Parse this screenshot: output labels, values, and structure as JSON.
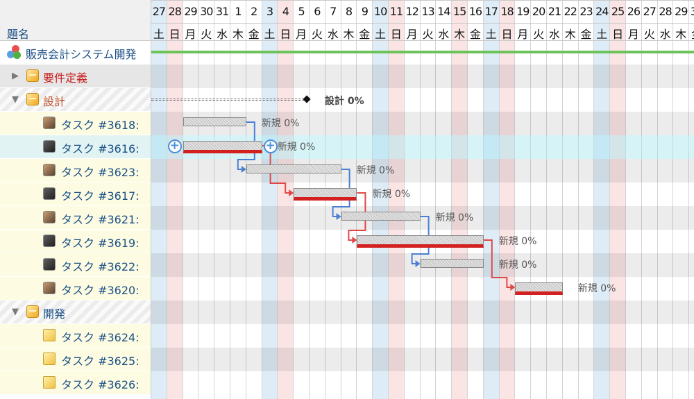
{
  "header": {
    "column_title": "題名",
    "days": [
      {
        "d": "27",
        "w": "土",
        "t": "sat"
      },
      {
        "d": "28",
        "w": "日",
        "t": "sun"
      },
      {
        "d": "29",
        "w": "月",
        "t": ""
      },
      {
        "d": "30",
        "w": "火",
        "t": ""
      },
      {
        "d": "31",
        "w": "水",
        "t": ""
      },
      {
        "d": "1",
        "w": "木",
        "t": ""
      },
      {
        "d": "2",
        "w": "金",
        "t": ""
      },
      {
        "d": "3",
        "w": "土",
        "t": "sat"
      },
      {
        "d": "4",
        "w": "日",
        "t": "sun"
      },
      {
        "d": "5",
        "w": "月",
        "t": ""
      },
      {
        "d": "6",
        "w": "火",
        "t": ""
      },
      {
        "d": "7",
        "w": "水",
        "t": ""
      },
      {
        "d": "8",
        "w": "木",
        "t": ""
      },
      {
        "d": "9",
        "w": "金",
        "t": ""
      },
      {
        "d": "10",
        "w": "土",
        "t": "sat"
      },
      {
        "d": "11",
        "w": "日",
        "t": "sun"
      },
      {
        "d": "12",
        "w": "月",
        "t": ""
      },
      {
        "d": "13",
        "w": "火",
        "t": ""
      },
      {
        "d": "14",
        "w": "水",
        "t": ""
      },
      {
        "d": "15",
        "w": "木",
        "t": "sun"
      },
      {
        "d": "16",
        "w": "金",
        "t": ""
      },
      {
        "d": "17",
        "w": "土",
        "t": "sat"
      },
      {
        "d": "18",
        "w": "日",
        "t": "sun"
      },
      {
        "d": "19",
        "w": "月",
        "t": ""
      },
      {
        "d": "20",
        "w": "火",
        "t": ""
      },
      {
        "d": "21",
        "w": "水",
        "t": ""
      },
      {
        "d": "22",
        "w": "木",
        "t": ""
      },
      {
        "d": "23",
        "w": "金",
        "t": ""
      },
      {
        "d": "24",
        "w": "土",
        "t": "sat"
      },
      {
        "d": "25",
        "w": "日",
        "t": "sun"
      },
      {
        "d": "26",
        "w": "月",
        "t": ""
      },
      {
        "d": "27",
        "w": "火",
        "t": ""
      },
      {
        "d": "28",
        "w": "水",
        "t": ""
      },
      {
        "d": "29",
        "w": "木",
        "t": ""
      },
      {
        "d": "30",
        "w": "金",
        "t": ""
      }
    ]
  },
  "rows": [
    {
      "kind": "project",
      "label": "販売会計システム開発",
      "name": "row-project"
    },
    {
      "kind": "group",
      "label": "要件定義",
      "open": false,
      "color": "#c81e1e",
      "name": "row-group-requirements"
    },
    {
      "kind": "group",
      "label": "設計",
      "open": true,
      "color": "#c0502a",
      "name": "row-group-design"
    },
    {
      "kind": "task",
      "label": "タスク #3618:",
      "avatar": "av1",
      "name": "row-task-3618"
    },
    {
      "kind": "task",
      "label": "タスク #3616:",
      "avatar": "av2",
      "name": "row-task-3616",
      "selected": true
    },
    {
      "kind": "task",
      "label": "タスク #3623:",
      "avatar": "av1",
      "name": "row-task-3623"
    },
    {
      "kind": "task",
      "label": "タスク #3617:",
      "avatar": "av2",
      "name": "row-task-3617"
    },
    {
      "kind": "task",
      "label": "タスク #3621:",
      "avatar": "av1",
      "name": "row-task-3621"
    },
    {
      "kind": "task",
      "label": "タスク #3619:",
      "avatar": "av2",
      "name": "row-task-3619"
    },
    {
      "kind": "task",
      "label": "タスク #3622:",
      "avatar": "av2",
      "name": "row-task-3622"
    },
    {
      "kind": "task",
      "label": "タスク #3620:",
      "avatar": "av1",
      "name": "row-task-3620"
    },
    {
      "kind": "group",
      "label": "開発",
      "open": true,
      "color": "#1a4f86",
      "name": "row-group-development"
    },
    {
      "kind": "task",
      "label": "タスク #3624:",
      "avatar": "doc",
      "name": "row-task-3624"
    },
    {
      "kind": "task",
      "label": "タスク #3625:",
      "avatar": "doc",
      "name": "row-task-3625"
    },
    {
      "kind": "task",
      "label": "タスク #3626:",
      "avatar": "doc",
      "name": "row-task-3626"
    }
  ],
  "bars": [
    {
      "row": 3,
      "start": 2,
      "end": 6,
      "label": "新規 0%",
      "critical": false
    },
    {
      "row": 4,
      "start": 2,
      "end": 7,
      "label": "新規 0%",
      "critical": true,
      "handles": true
    },
    {
      "row": 5,
      "start": 6,
      "end": 12,
      "label": "新規 0%",
      "critical": false
    },
    {
      "row": 6,
      "start": 9,
      "end": 13,
      "label": "新規 0%",
      "critical": true
    },
    {
      "row": 7,
      "start": 12,
      "end": 17,
      "label": "新規 0%",
      "critical": false
    },
    {
      "row": 8,
      "start": 13,
      "end": 21,
      "label": "新規 0%",
      "critical": true
    },
    {
      "row": 9,
      "start": 17,
      "end": 21,
      "label": "新規 0%",
      "critical": false
    },
    {
      "row": 10,
      "start": 23,
      "end": 26,
      "label": "新規 0%",
      "critical": true
    }
  ],
  "summary": {
    "row": 2,
    "start": 0,
    "end": 10,
    "label": "設計 0%"
  },
  "links": [
    {
      "from": 3,
      "to": 5,
      "color": "#4a7fd4"
    },
    {
      "from": 4,
      "to": 6,
      "color": "#e04848"
    },
    {
      "from": 5,
      "to": 7,
      "color": "#4a7fd4"
    },
    {
      "from": 6,
      "to": 8,
      "color": "#e04848"
    },
    {
      "from": 7,
      "to": 9,
      "color": "#4a7fd4"
    },
    {
      "from": 8,
      "to": 10,
      "color": "#e04848"
    }
  ],
  "colors": {
    "sat": "#c3dcf0",
    "sun": "#f5cdcd",
    "critical": "#d32020",
    "link_blue": "#4a7fd4",
    "link_red": "#e04848",
    "project_line": "#6cc35a"
  }
}
